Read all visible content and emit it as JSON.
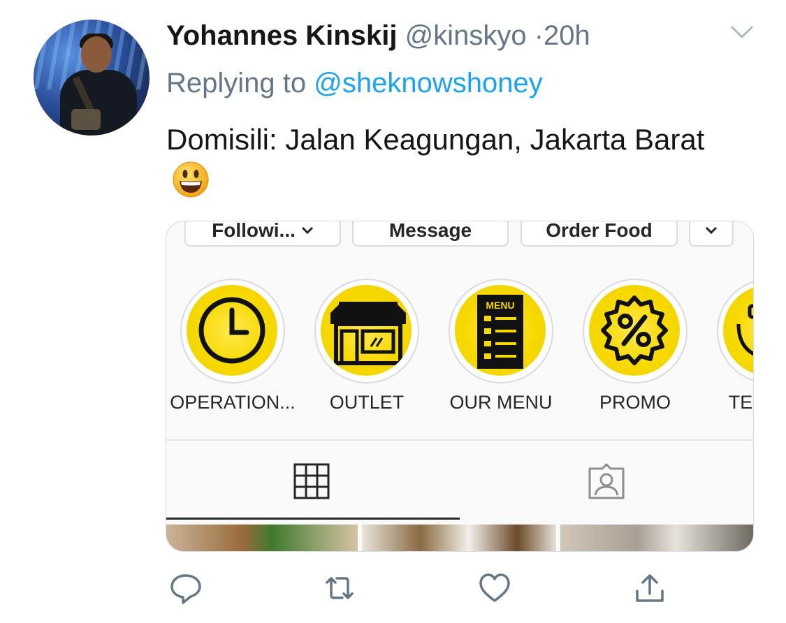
{
  "tweet": {
    "author_name": "Yohannes Kinskij",
    "author_handle": "@kinskyo",
    "separator": "·",
    "time": "20h",
    "replying_prefix": "Replying to",
    "replying_to": "@sheknowshoney",
    "text": "Domisili: Jalan Keagungan, Jakarta Barat",
    "emoji": "grinning-face-emoji"
  },
  "embedded_screenshot": {
    "buttons": [
      "Followi...",
      "Message",
      "Order Food"
    ],
    "highlights": [
      {
        "label": "OPERATION...",
        "icon": "clock-icon"
      },
      {
        "label": "OUTLET",
        "icon": "storefront-icon"
      },
      {
        "label": "OUR MENU",
        "icon": "menu-list-icon",
        "icon_text": "MENU"
      },
      {
        "label": "PROMO",
        "icon": "percent-badge-icon"
      },
      {
        "label": "TES",
        "icon": "partial-icon"
      }
    ],
    "tabs": [
      "grid-icon",
      "tagged-icon"
    ],
    "highlight_color": "#f7d900"
  },
  "actions": [
    "reply-icon",
    "retweet-icon",
    "like-icon",
    "share-icon"
  ],
  "colors": {
    "text": "#14171a",
    "secondary": "#657786",
    "link": "#1da1f2"
  }
}
